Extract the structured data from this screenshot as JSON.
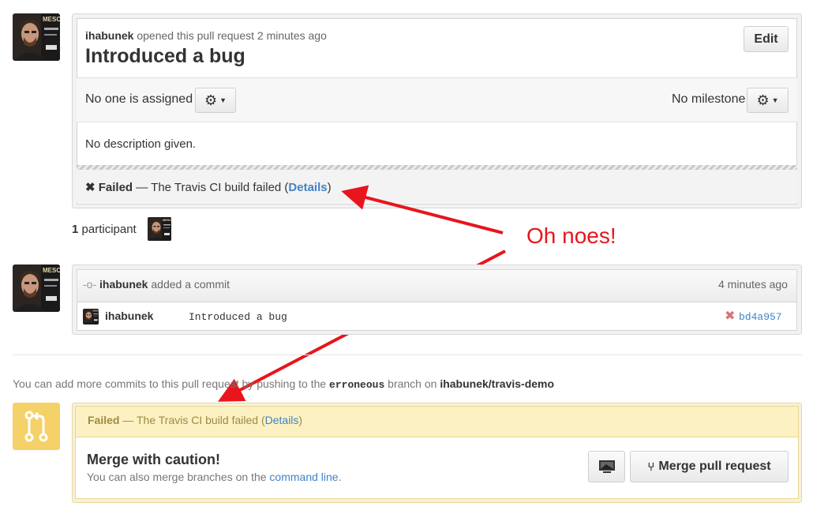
{
  "pr": {
    "author": "ihabunek",
    "opened_text": "opened this pull request 2 minutes ago",
    "title": "Introduced a bug",
    "edit_label": "Edit",
    "assignee_text": "No one is assigned",
    "milestone_text": "No milestone",
    "description": "No description given.",
    "status": {
      "label": "Failed",
      "text": "— The Travis CI build failed (",
      "details": "Details",
      "close_paren": ")"
    }
  },
  "participants": {
    "count": "1",
    "label": "participant"
  },
  "annotation": {
    "text": "Oh noes!",
    "color": "#e8151c"
  },
  "commit_event": {
    "author": "ihabunek",
    "action": "added a commit",
    "time": "4 minutes ago",
    "commit": {
      "author": "ihabunek",
      "message": "Introduced a bug",
      "sha": "bd4a957"
    }
  },
  "push_hint": {
    "prefix": "You can add more commits to this pull request by pushing to the",
    "branch": "erroneous",
    "middle": "branch on",
    "repo": "ihabunek/travis-demo"
  },
  "merge": {
    "status_label": "Failed",
    "status_text": "— The Travis CI build failed (",
    "status_details": "Details",
    "status_close": ")",
    "heading": "Merge with caution!",
    "sub_prefix": "You can also merge branches on the",
    "sub_link": "command line",
    "sub_suffix": ".",
    "merge_button": "Merge pull request"
  },
  "colors": {
    "link": "#4183c4",
    "warning_bg": "#fbf1c3",
    "warning_text": "#a08a40",
    "icon_yellow": "#f4d169"
  }
}
